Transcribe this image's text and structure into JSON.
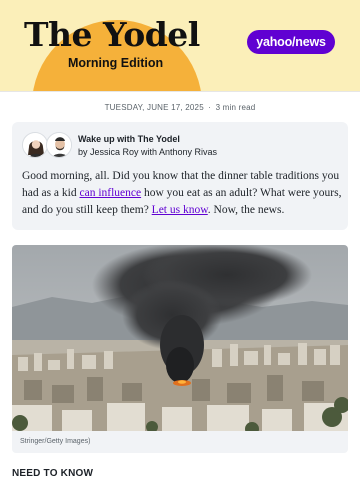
{
  "header": {
    "title": "The Yodel",
    "subtitle": "Morning Edition",
    "partner_logo": "yahoo/news",
    "colors": {
      "background": "#fbefb9",
      "sun": "#f5b13a",
      "partner": "#6001d2"
    }
  },
  "dateline": {
    "date": "TUESDAY, JUNE 17, 2025",
    "separator": "·",
    "read_time": "3 min read"
  },
  "intro_card": {
    "title": "Wake up with The Yodel",
    "authors": "by Jessica Roy with Anthony Rivas",
    "body": {
      "part1": "Good morning, all. Did you know that the dinner table traditions you had as a kid ",
      "link1": "can influence",
      "part2": " how you eat as an adult? What were yours, and do you still keep them? ",
      "link2": "Let us know",
      "part3": ". Now, the news."
    }
  },
  "photo": {
    "icon": "smoke-over-city-photo",
    "caption": "Stringer/Getty Images)"
  },
  "section": {
    "heading": "NEED TO KNOW"
  }
}
